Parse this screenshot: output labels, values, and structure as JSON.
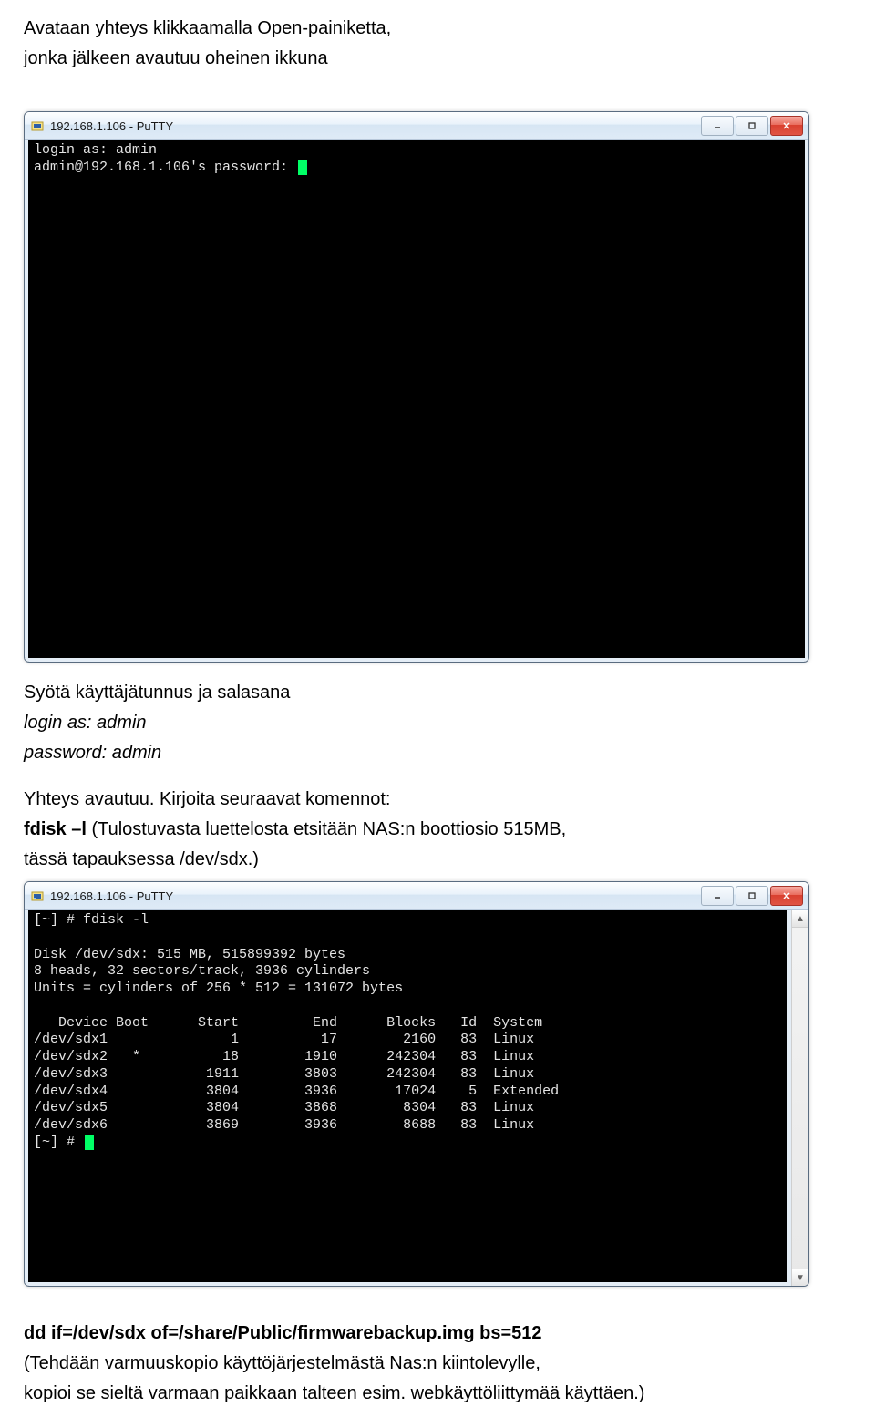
{
  "intro": {
    "line1": "Avataan yhteys klikkaamalla Open-painiketta,",
    "line2": "jonka jälkeen avautuu oheinen ikkuna"
  },
  "window1": {
    "title": "192.168.1.106 - PuTTY",
    "terminal": "login as: admin\nadmin@192.168.1.106's password: "
  },
  "after_win1": {
    "line1": "Syötä käyttäjätunnus ja salasana",
    "line2": "login as: admin",
    "line3": "password: admin"
  },
  "mid": {
    "line1": "Yhteys avautuu. Kirjoita seuraavat komennot:",
    "line2a": "fdisk –l",
    "line2b": "   (Tulostuvasta luettelosta etsitään NAS:n boottiosio 515MB,",
    "line3": "tässä tapauksessa /dev/sdx.)"
  },
  "window2": {
    "title": "192.168.1.106 - PuTTY",
    "terminal": "[~] # fdisk -l\n\nDisk /dev/sdx: 515 MB, 515899392 bytes\n8 heads, 32 sectors/track, 3936 cylinders\nUnits = cylinders of 256 * 512 = 131072 bytes\n\n   Device Boot      Start         End      Blocks   Id  System\n/dev/sdx1               1          17        2160   83  Linux\n/dev/sdx2   *          18        1910      242304   83  Linux\n/dev/sdx3            1911        3803      242304   83  Linux\n/dev/sdx4            3804        3936       17024    5  Extended\n/dev/sdx5            3804        3868        8304   83  Linux\n/dev/sdx6            3869        3936        8688   83  Linux\n[~] # "
  },
  "footer": {
    "line1a": "dd if=/dev/sdx  of=/share/Public/firmwarebackup.img bs=512",
    "line2": "(Tehdään varmuuskopio käyttöjärjestelmästä Nas:n kiintolevylle,",
    "line3": "kopioi se sieltä varmaan paikkaan talteen esim. webkäyttöliittymää käyttäen.)"
  }
}
